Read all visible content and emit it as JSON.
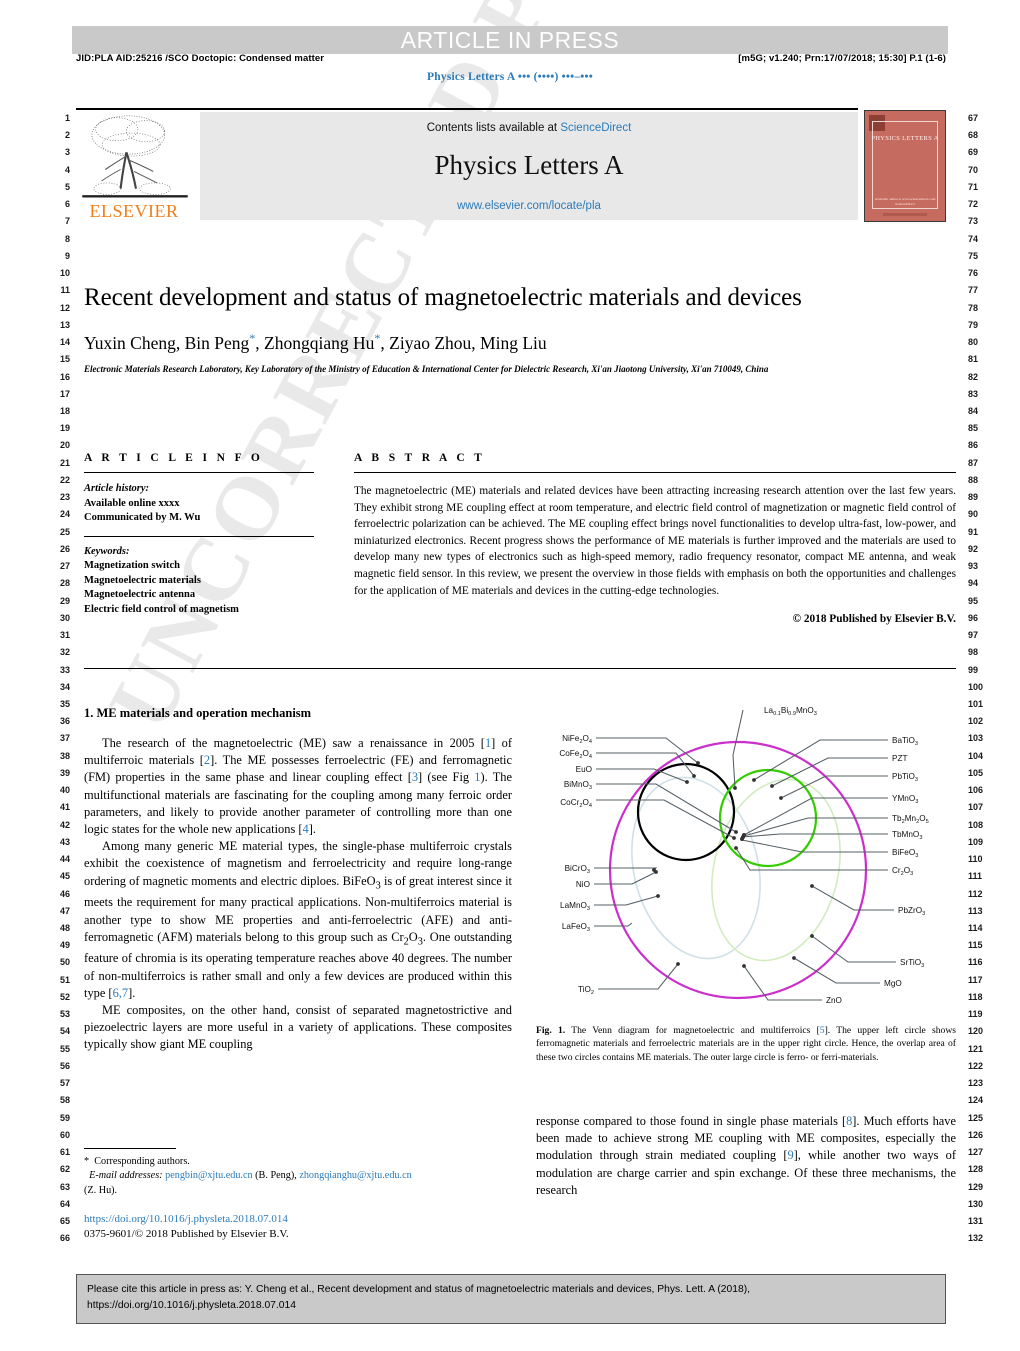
{
  "header": {
    "press_banner": "ARTICLE IN PRESS",
    "jid_left": "JID:PLA    AID:25216 /SCO    Doctopic: Condensed matter",
    "jid_right": "[m5G; v1.240; Prn:17/07/2018; 15:30] P.1 (1-6)",
    "running_head": "Physics Letters A ••• (••••) •••–•••"
  },
  "masthead": {
    "contents_prefix": "Contents lists available at ",
    "sciencedirect": "ScienceDirect",
    "journal_title": "Physics Letters A",
    "journal_url": "www.elsevier.com/locate/pla",
    "publisher": "ELSEVIER",
    "cover_title": "PHYSICS LETTERS A",
    "cover_footer": "Available online at www.sciencedirect.com\nScienceDirect"
  },
  "article": {
    "title": "Recent development and status of magnetoelectric materials and devices",
    "authors": "Yuxin Cheng, Bin Peng",
    "authors_full": "Yuxin Cheng, Bin Peng*, Zhongqiang Hu*, Ziyao Zhou, Ming Liu",
    "author_parts": [
      "Yuxin Cheng, Bin Peng",
      ", Zhongqiang Hu",
      ", Ziyao Zhou, Ming Liu"
    ],
    "affiliation": "Electronic Materials Research Laboratory, Key Laboratory of the Ministry of Education & International Center for Dielectric Research, Xi'an Jiaotong University, Xi'an 710049, China"
  },
  "info": {
    "heading": "A R T I C L E  I N F O",
    "history_label": "Article history:",
    "history_lines": [
      "Available online xxxx",
      "Communicated by M. Wu"
    ],
    "keywords_label": "Keywords:",
    "keywords": [
      "Magnetization switch",
      "Magnetoelectric materials",
      "Magnetoelectric antenna",
      "Electric field control of magnetism"
    ]
  },
  "abstract": {
    "heading": "A B S T R A C T",
    "text": "The magnetoelectric (ME) materials and related devices have been attracting increasing research attention over the last few years. They exhibit strong ME coupling effect at room temperature, and electric field control of magnetization or magnetic field control of ferroelectric polarization can be achieved. The ME coupling effect brings novel functionalities to develop ultra-fast, low-power, and miniaturized electronics. Recent progress shows the performance of ME materials is further improved and the materials are used to develop many new types of electronics such as high-speed memory, radio frequency resonator, compact ME antenna, and weak magnetic field sensor. In this review, we present the overview in those fields with emphasis on both the opportunities and challenges for the application of ME materials and devices in the cutting-edge technologies.",
    "copyright": "© 2018 Published by Elsevier B.V."
  },
  "section": {
    "heading": "1. ME materials and operation mechanism",
    "paragraphs": [
      "The research of the magnetoelectric (ME) saw a renaissance in 2005 [1] of multiferroic materials [2]. The ME possesses ferroelectric (FE) and ferromagnetic (FM) properties in the same phase and linear coupling effect [3] (see Fig 1). The multifunctional materials are fascinating for the coupling among many ferroic order parameters, and likely to provide another parameter of controlling more than one logic states for the whole new applications [4].",
      "Among many generic ME material types, the single-phase multiferroic crystals exhibit the coexistence of magnetism and ferroelectricity and require long-range ordering of magnetic moments and electric diploes. BiFeO3 is of great interest since it meets the requirement for many practical applications. Non-multiferroics material is another type to show ME properties and anti-ferroelectric (AFE) and anti-ferromagnetic (AFM) materials belong to this group such as Cr2O3. One outstanding feature of chromia is its operating temperature reaches above 40 degrees. The number of non-multiferroics is rather small and only a few devices are produced within this type [6,7].",
      "ME composites, on the other hand, consist of separated magnetostrictive and piezoelectric layers are more useful in a variety of applications. These composites typically show giant ME coupling",
      "response compared to those found in single phase materials [8]. Much efforts have been made to achieve strong ME coupling with ME composites, especially the modulation through strain mediated coupling [9], while another two ways of modulation are charge carrier and spin exchange. Of these three mechanisms, the research"
    ]
  },
  "footnote": {
    "corresponding": "Corresponding authors.",
    "email_label": "E-mail addresses:",
    "email_1": "pengbin@xjtu.edu.cn",
    "email_1_owner": "(B. Peng),",
    "email_2": "zhongqianghu@xjtu.edu.cn",
    "email_2_owner": "(Z. Hu).",
    "doi": "https://doi.org/10.1016/j.physleta.2018.07.014",
    "issn_line": "0375-9601/© 2018 Published by Elsevier B.V."
  },
  "figure": {
    "caption_label": "Fig. 1.",
    "caption_text": " The Venn diagram for magnetoelectric and multiferroics [5]. The upper left circle shows ferromagnetic materials and ferroelectric materials are in the upper right circle. Hence, the overlap area of these two circles contains ME materials. The outer large circle is ferro- or ferri-materials.",
    "caption_ref": "5",
    "colors": {
      "outer": "#cc2ecc",
      "ferromagnetic": "#000000",
      "ferroelectric": "#33cc00",
      "faint_blue": "#cfe0e6",
      "faint_green": "#d2ecc0",
      "leader": "#555f66"
    },
    "labels_top": [
      "La0.1Bi0.9MnO3"
    ],
    "labels_left": [
      "NiFe2O4",
      "CoFe2O4",
      "EuO",
      "BiMnO3",
      "CoCr2O4",
      "BiCrO3",
      "NiO",
      "LaMnO3",
      "LaFeO3",
      "TiO2"
    ],
    "labels_right": [
      "BaTiO3",
      "PZT",
      "PbTiO3",
      "YMnO3",
      "Tb2Mn2O5",
      "TbMnO3",
      "BiFeO3",
      "Cr2O3",
      "PbZrO3",
      "SrTiO3",
      "MgO"
    ],
    "labels_bottom": [
      "ZnO"
    ]
  },
  "linenumbers": {
    "left_start": 1,
    "left_end": 66,
    "right_start": 67,
    "right_end": 132
  },
  "cite_footer": {
    "line1": "Please cite this article in press as: Y. Cheng et al., Recent development and status of magnetoelectric materials and devices, Phys. Lett. A (2018),",
    "line2": "https://doi.org/10.1016/j.physleta.2018.07.014"
  },
  "watermark": "UNCORRECTED PROOF"
}
